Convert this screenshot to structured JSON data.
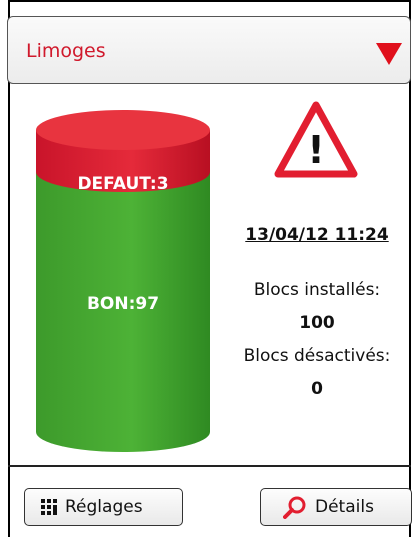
{
  "location": {
    "selected": "Limoges"
  },
  "status_chart": {
    "defaut_label": "DEFAUT:3",
    "bon_label": "BON:97",
    "defaut_count": 3,
    "bon_count": 97,
    "colors": {
      "defaut": "#e21e30",
      "bon": "#3f9e2c"
    }
  },
  "alert": {
    "icon": "warning-triangle-icon",
    "symbol": "!"
  },
  "summary": {
    "datetime": "13/04/12 11:24",
    "installed_label": "Blocs installés:",
    "installed_value": "100",
    "disabled_label": "Blocs désactivés:",
    "disabled_value": "0"
  },
  "footer": {
    "settings_label": "Réglages",
    "settings_icon": "grid-settings-icon",
    "details_label": "Détails",
    "details_icon": "magnifier-icon"
  }
}
